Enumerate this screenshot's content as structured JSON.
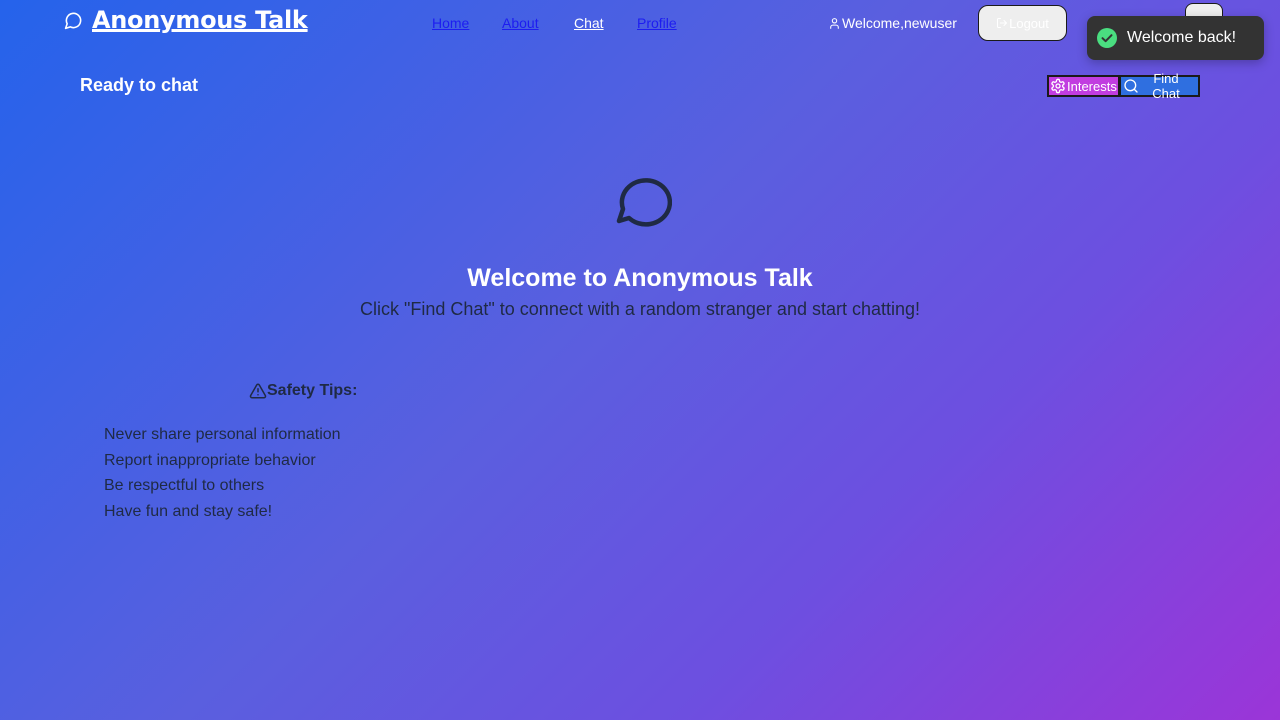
{
  "header": {
    "app_title": "Anonymous Talk",
    "nav": [
      {
        "label": "Home",
        "active": false
      },
      {
        "label": "About",
        "active": false
      },
      {
        "label": "Chat",
        "active": true
      },
      {
        "label": "Profile",
        "active": false
      }
    ],
    "welcome_text": "Welcome,newuser",
    "logout_label": "Logout"
  },
  "toast": {
    "message": "Welcome back!",
    "status": "success",
    "icon": "check-circle-icon"
  },
  "status": {
    "text": "Ready to chat",
    "interests_label": "Interests",
    "find_chat_label": "Find Chat"
  },
  "main": {
    "icon": "chat-bubble-icon",
    "title": "Welcome to Anonymous Talk",
    "subtitle": "Click \"Find Chat\" to connect with a random stranger and start chatting!"
  },
  "safety": {
    "heading": "Safety Tips:",
    "tips": [
      "Never share personal information",
      "Report inappropriate behavior",
      "Be respectful to others",
      "Have fun and stay safe!"
    ]
  },
  "colors": {
    "gradient_start": "#2563eb",
    "gradient_end": "#9b35d8",
    "interests_button": "#c13de0",
    "find_chat_button": "#2f6fe0",
    "toast_bg": "#333333",
    "toast_check": "#4ade80",
    "dark_text": "#1f2a44",
    "link_color": "#1d1df0"
  }
}
